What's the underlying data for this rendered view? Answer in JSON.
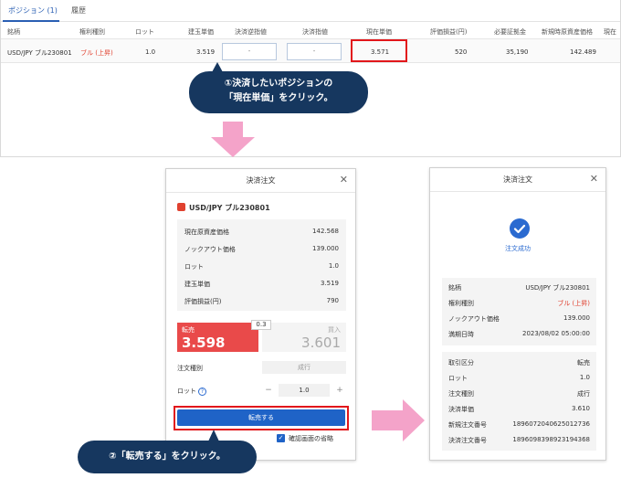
{
  "positions": {
    "tabs": [
      {
        "label": "ポジション (1)",
        "active": true
      },
      {
        "label": "履歴",
        "active": false
      }
    ],
    "headers": [
      "銘柄",
      "権利種別",
      "ロット",
      "建玉単価",
      "決済逆指値",
      "決済指値",
      "現在単価",
      "評価損益(円)",
      "必要証拠金",
      "新規時原資産価格",
      "現在"
    ],
    "row": {
      "symbol": "USD/JPY ブル230801",
      "right_type": "ブル (上昇)",
      "lot": "1.0",
      "entry_price": "3.519",
      "stop_value": "-",
      "limit_value": "-",
      "current_price": "3.571",
      "pnl": "520",
      "margin": "35,190",
      "initial_underlying": "142.489"
    }
  },
  "callout1": {
    "line1": "①決済したいポジションの",
    "line2": "「現在単価」をクリック。"
  },
  "order_panel": {
    "title": "決済注文",
    "close": "✕",
    "symbol": "USD/JPY ブル230801",
    "info": [
      {
        "label": "現在原資産価格",
        "value": "142.568"
      },
      {
        "label": "ノックアウト価格",
        "value": "139.000"
      },
      {
        "label": "ロット",
        "value": "1.0"
      },
      {
        "label": "建玉単価",
        "value": "3.519"
      },
      {
        "label": "評価損益(円)",
        "value": "790"
      }
    ],
    "sell": {
      "label": "転売",
      "price": "3.598"
    },
    "buy": {
      "label": "買入",
      "price": "3.601"
    },
    "spread": "0.3",
    "order_type_label": "注文種別",
    "order_type_value": "成行",
    "lot_label": "ロット",
    "help": "?",
    "lot_minus": "−",
    "lot_value": "1.0",
    "lot_plus": "+",
    "submit_label": "転売する",
    "skip_confirm_label": "確認画面の省略",
    "skip_confirm_check": "✓"
  },
  "callout2": {
    "text": "②「転売する」をクリック。"
  },
  "result_panel": {
    "title": "決済注文",
    "close": "✕",
    "success_text": "注文成功",
    "info1": [
      {
        "label": "銘柄",
        "value": "USD/JPY ブル230801",
        "red": false
      },
      {
        "label": "権利種別",
        "value": "ブル (上昇)",
        "red": true
      },
      {
        "label": "ノックアウト価格",
        "value": "139.000",
        "red": false
      },
      {
        "label": "満期日時",
        "value": "2023/08/02 05:00:00",
        "red": false
      }
    ],
    "info2": [
      {
        "label": "取引区分",
        "value": "転売"
      },
      {
        "label": "ロット",
        "value": "1.0"
      },
      {
        "label": "注文種別",
        "value": "成行"
      },
      {
        "label": "決済単価",
        "value": "3.610"
      },
      {
        "label": "新規注文番号",
        "value": "1896072040625012736"
      },
      {
        "label": "決済注文番号",
        "value": "1896098398923194368"
      }
    ]
  },
  "colors": {
    "accent_blue": "#1f63c7",
    "sell_red": "#e94a4a",
    "highlight_red": "#e2171b",
    "callout_navy": "#16375f",
    "arrow_pink": "#f4a3c9"
  }
}
